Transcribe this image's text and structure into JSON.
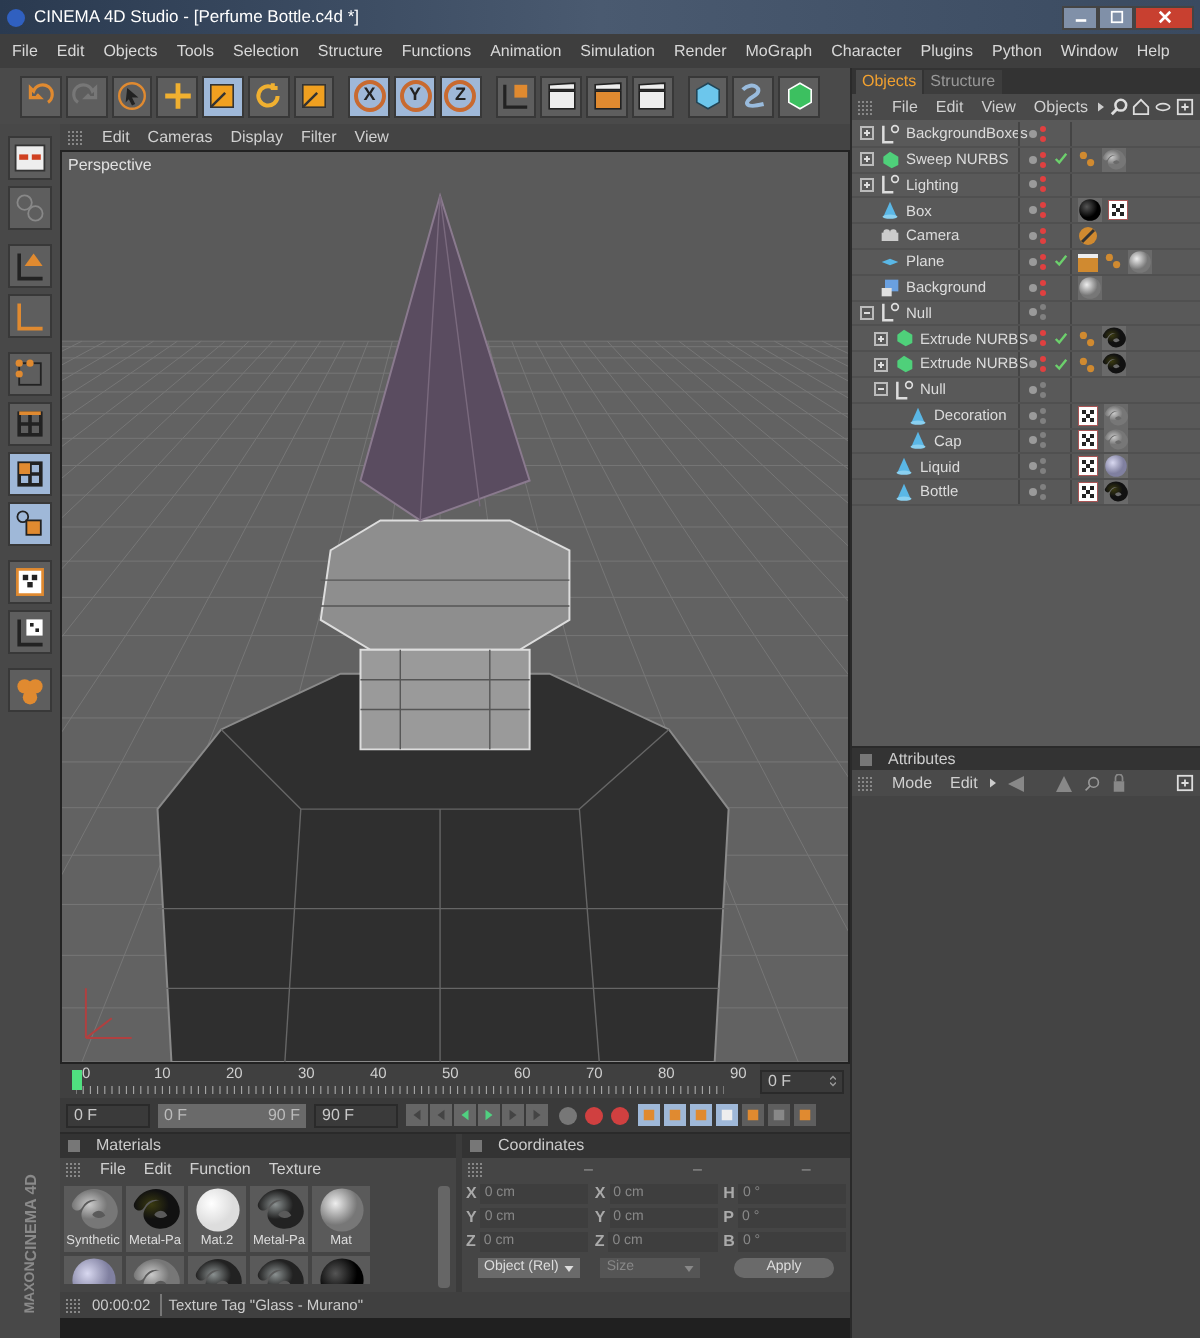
{
  "window": {
    "title": "CINEMA 4D Studio - [Perfume Bottle.c4d *]"
  },
  "menu": [
    "File",
    "Edit",
    "Objects",
    "Tools",
    "Selection",
    "Structure",
    "Functions",
    "Animation",
    "Simulation",
    "Render",
    "MoGraph",
    "Character",
    "Plugins",
    "Python",
    "Window",
    "Help"
  ],
  "toolbar": [
    {
      "kind": "undo",
      "selected": false
    },
    {
      "kind": "redo",
      "selected": false
    },
    {
      "kind": "select",
      "selected": false
    },
    {
      "kind": "move",
      "selected": false
    },
    {
      "kind": "scale",
      "selected": true
    },
    {
      "kind": "rotate",
      "selected": false
    },
    {
      "kind": "recent",
      "selected": false
    },
    {
      "kind": "axis",
      "label": "X",
      "selected": true
    },
    {
      "kind": "axis",
      "label": "Y",
      "selected": true
    },
    {
      "kind": "axis",
      "label": "Z",
      "selected": true
    },
    {
      "kind": "coords",
      "selected": false
    },
    {
      "kind": "render-view",
      "selected": false
    },
    {
      "kind": "render-picture",
      "selected": false
    },
    {
      "kind": "render-settings",
      "selected": false
    },
    {
      "kind": "cube",
      "selected": false
    },
    {
      "kind": "spline",
      "selected": false
    },
    {
      "kind": "nurbs",
      "selected": false
    }
  ],
  "left_tools": [
    {
      "kind": "layout",
      "selected": false
    },
    {
      "kind": "model",
      "selected": false
    },
    {
      "kind": "object-axis",
      "selected": false
    },
    {
      "kind": "axis",
      "selected": false
    },
    {
      "kind": "points",
      "selected": false
    },
    {
      "kind": "edges",
      "selected": false
    },
    {
      "kind": "polygons",
      "selected": true
    },
    {
      "kind": "uv",
      "selected": true
    },
    {
      "kind": "texture",
      "selected": false
    },
    {
      "kind": "texture-axis",
      "selected": false
    },
    {
      "kind": "spheres",
      "selected": false
    }
  ],
  "brand": [
    "MAXON",
    "CINEMA 4D"
  ],
  "viewport": {
    "menu": [
      "Edit",
      "Cameras",
      "Display",
      "Filter",
      "View"
    ],
    "camera": "Perspective"
  },
  "timeline": {
    "ticks": [
      "0",
      "10",
      "20",
      "30",
      "40",
      "50",
      "60",
      "70",
      "80",
      "90"
    ],
    "frame": "0 F"
  },
  "transport": {
    "start": "0 F",
    "range_start": "0 F",
    "range_end": "90 F",
    "end": "90 F",
    "level": 1
  },
  "materials": {
    "title": "Materials",
    "menu": [
      "File",
      "Edit",
      "Function",
      "Texture"
    ],
    "items": [
      {
        "name": "Synthetic",
        "kind": "knot"
      },
      {
        "name": "Metal-Pa",
        "kind": "dark-knot"
      },
      {
        "name": "Mat.2",
        "kind": "white"
      },
      {
        "name": "Metal-Pa",
        "kind": "chrome-knot"
      },
      {
        "name": "Mat",
        "kind": "sphere"
      }
    ],
    "more": [
      {
        "kind": "glass"
      },
      {
        "kind": "knot"
      },
      {
        "kind": "chrome-knot"
      },
      {
        "kind": "chrome-knot"
      },
      {
        "kind": "dark-sphere"
      }
    ]
  },
  "coordinates": {
    "title": "Coordinates",
    "columns": [
      "–",
      "–",
      "–"
    ],
    "rows": [
      [
        {
          "axis": "X",
          "value": "0 cm"
        },
        {
          "axis": "X",
          "value": "0 cm"
        },
        {
          "axis": "H",
          "value": "0 °"
        }
      ],
      [
        {
          "axis": "Y",
          "value": "0 cm"
        },
        {
          "axis": "Y",
          "value": "0 cm"
        },
        {
          "axis": "P",
          "value": "0 °"
        }
      ],
      [
        {
          "axis": "Z",
          "value": "0 cm"
        },
        {
          "axis": "Z",
          "value": "0 cm"
        },
        {
          "axis": "B",
          "value": "0 °"
        }
      ]
    ],
    "mode": "Object (Rel)",
    "size": "Size",
    "apply": "Apply"
  },
  "status": {
    "time": "00:00:02",
    "message": "Texture Tag \"Glass - Murano\""
  },
  "objects": {
    "tabs": [
      {
        "label": "Objects",
        "selected": true
      },
      {
        "label": "Structure",
        "selected": false
      }
    ],
    "menu": [
      "File",
      "Edit",
      "View",
      "Objects"
    ],
    "tree": [
      {
        "name": "BackgroundBoxes",
        "kind": "null",
        "expanded": false,
        "hidden": true,
        "checked": false
      },
      {
        "name": "Sweep NURBS",
        "kind": "nurbs",
        "expanded": false,
        "hidden": true,
        "checked": true,
        "tags": [
          {
            "kind": "phong"
          },
          {
            "kind": "knot"
          }
        ]
      },
      {
        "name": "Lighting",
        "kind": "null",
        "expanded": false,
        "hidden": true,
        "checked": false
      },
      {
        "name": "Box",
        "kind": "primitive",
        "hidden": true,
        "checked": false,
        "tags": [
          {
            "kind": "dark-sphere"
          },
          {
            "kind": "checker"
          }
        ]
      },
      {
        "name": "Camera",
        "kind": "camera",
        "hidden": true,
        "checked": false,
        "tags": [
          {
            "kind": "target"
          }
        ]
      },
      {
        "name": "Plane",
        "kind": "plane",
        "hidden": true,
        "checked": true,
        "tags": [
          {
            "kind": "compositing"
          },
          {
            "kind": "phong"
          },
          {
            "kind": "sphere"
          }
        ]
      },
      {
        "name": "Background",
        "kind": "background",
        "hidden": true,
        "checked": false,
        "tags": [
          {
            "kind": "sphere"
          }
        ]
      },
      {
        "name": "Null",
        "kind": "null",
        "expanded": true,
        "hidden": false,
        "checked": false,
        "children": [
          {
            "name": "Extrude NURBS",
            "kind": "nurbs",
            "expanded": false,
            "hidden": true,
            "checked": true,
            "tags": [
              {
                "kind": "phong"
              },
              {
                "kind": "dark-knot"
              }
            ]
          },
          {
            "name": "Extrude NURBS",
            "kind": "nurbs",
            "expanded": false,
            "hidden": true,
            "checked": true,
            "tags": [
              {
                "kind": "phong"
              },
              {
                "kind": "dark-knot"
              }
            ]
          },
          {
            "name": "Null",
            "kind": "null",
            "expanded": true,
            "hidden": false,
            "checked": false,
            "children": [
              {
                "name": "Decoration",
                "kind": "primitive",
                "hidden": false,
                "checked": false,
                "tags": [
                  {
                    "kind": "checker"
                  },
                  {
                    "kind": "knot"
                  }
                ]
              },
              {
                "name": "Cap",
                "kind": "primitive",
                "hidden": false,
                "checked": false,
                "tags": [
                  {
                    "kind": "checker"
                  },
                  {
                    "kind": "knot"
                  }
                ]
              }
            ]
          },
          {
            "name": "Liquid",
            "kind": "primitive",
            "hidden": false,
            "checked": false,
            "tags": [
              {
                "kind": "checker"
              },
              {
                "kind": "glass"
              }
            ]
          },
          {
            "name": "Bottle",
            "kind": "primitive",
            "hidden": false,
            "checked": false,
            "tags": [
              {
                "kind": "checker"
              },
              {
                "kind": "dark-knot"
              }
            ]
          }
        ]
      }
    ]
  },
  "attributes": {
    "title": "Attributes",
    "menu": [
      "Mode",
      "Edit"
    ]
  }
}
